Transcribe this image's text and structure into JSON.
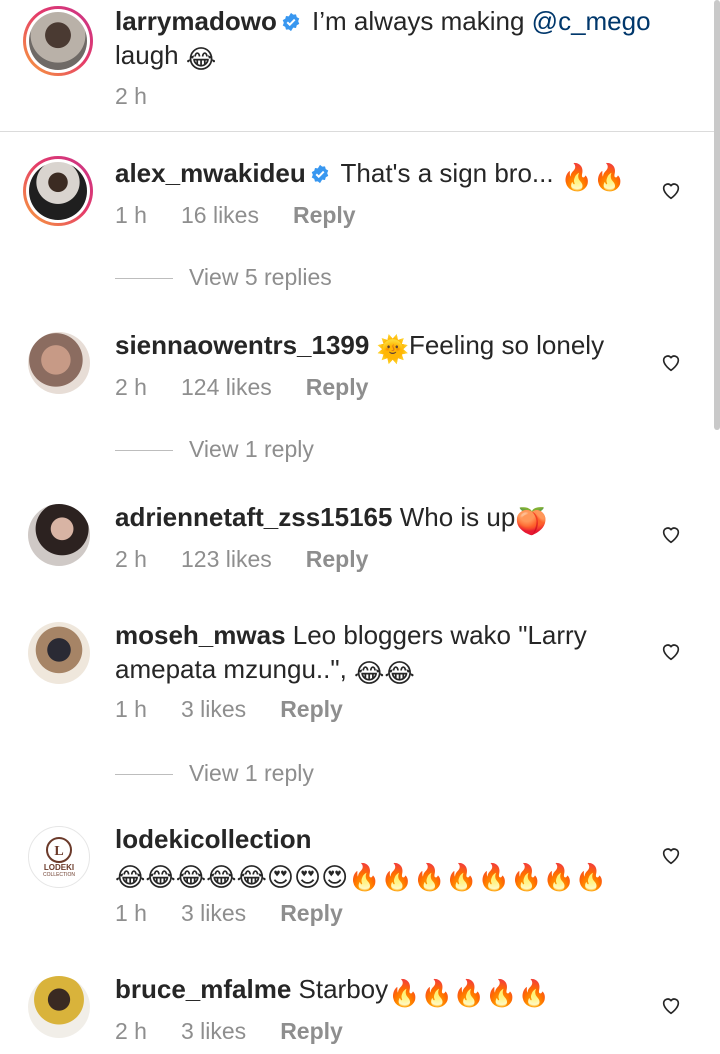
{
  "caption": {
    "username": "larrymadowo",
    "text_before": " I’m always making ",
    "mention": "@c_mego",
    "text_after": " laugh ",
    "emoji": "😂",
    "time": "2 h"
  },
  "comments": [
    {
      "username": "alex_mwakideu",
      "verified": true,
      "text": " That's a sign bro... ",
      "emojis": "🔥🔥",
      "time": "1 h",
      "likes": "16 likes",
      "reply": "Reply",
      "view_replies": "View 5 replies"
    },
    {
      "username": "siennaowentrs_1399",
      "verified": false,
      "text": "Feeling so lonely",
      "emoji_before": "🌞",
      "time": "2 h",
      "likes": "124 likes",
      "reply": "Reply",
      "view_replies": "View 1 reply"
    },
    {
      "username": "adriennetaft_zss15165",
      "verified": false,
      "text": " Who is up",
      "emojis": "🍑",
      "time": "2 h",
      "likes": "123 likes",
      "reply": "Reply"
    },
    {
      "username": "moseh_mwas",
      "verified": false,
      "text": " Leo bloggers wako \"Larry amepata mzungu..\", ",
      "emojis": "😂😂",
      "time": "1 h",
      "likes": "3 likes",
      "reply": "Reply",
      "view_replies": "View 1 reply"
    },
    {
      "username": "lodekicollection",
      "verified": false,
      "text": " ",
      "emojis": "😂😂😂😂😂😍😍😍🔥🔥🔥🔥🔥🔥🔥🔥",
      "time": "1 h",
      "likes": "3 likes",
      "reply": "Reply",
      "avatar_logo": "LODEKI",
      "avatar_logo_sub": "COLLECTION"
    },
    {
      "username": "bruce_mfalme",
      "verified": false,
      "text": " Starboy",
      "emojis": "🔥🔥🔥🔥🔥",
      "time": "2 h",
      "likes": "3 likes",
      "reply": "Reply"
    }
  ],
  "colors": {
    "text": "#262626",
    "secondary": "#8e8e8e",
    "verified": "#3897f0",
    "mention": "#00376b",
    "divider": "#dbdbdb"
  },
  "icons": {
    "verified": "verified-badge-icon",
    "like": "heart-outline-icon"
  }
}
